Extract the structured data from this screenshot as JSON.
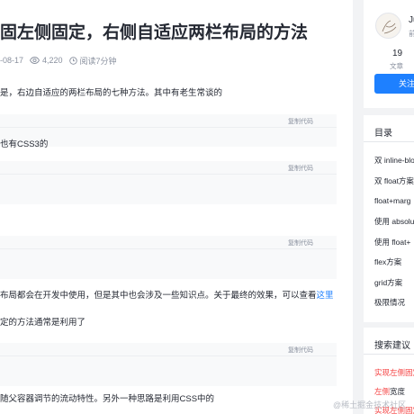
{
  "article": {
    "title": "固左侧固定，右侧自适应两栏布局的方法",
    "meta": {
      "date": "-08-17",
      "views": "4,220",
      "read_time": "阅读7分钟"
    },
    "paragraphs": {
      "p1": "是，右边自适应的两栏布局的七种方法。其中有老生常谈的",
      "p2": "也有CSS3的",
      "p3_text": "布局都会在开发中使用，但是其中也会涉及一些知识点。关于最终的效果，可以查看",
      "p3_link": "这里",
      "p4": "定的方法通常是利用了",
      "p5": "随父容器调节的流动特性。另外一种思路是利用CSS中的"
    },
    "copy_label": "复制代码"
  },
  "sidebar": {
    "author": {
      "name": "Ju",
      "level": "前",
      "stat_value": "19",
      "stat_label": "文章",
      "follow_label": "关注"
    },
    "toc": {
      "heading": "目录",
      "items": [
        "双 inline-blo",
        "双 float方案",
        "float+marg",
        "使用 absolu",
        "使用 float+",
        "flex方案",
        "grid方案",
        "极限情况"
      ]
    },
    "suggest": {
      "heading": "搜索建议",
      "items": [
        {
          "hl": "实现左侧固定",
          "rest": ""
        },
        {
          "hl": "左侧",
          "rest": "宽度"
        },
        {
          "hl": "实现左侧固定",
          "rest": ""
        }
      ]
    }
  },
  "watermark": "@稀土掘金技术社区",
  "colors": {
    "accent": "#1e80ff",
    "highlight": "#f53f3f",
    "background": "#f2f3f5"
  }
}
